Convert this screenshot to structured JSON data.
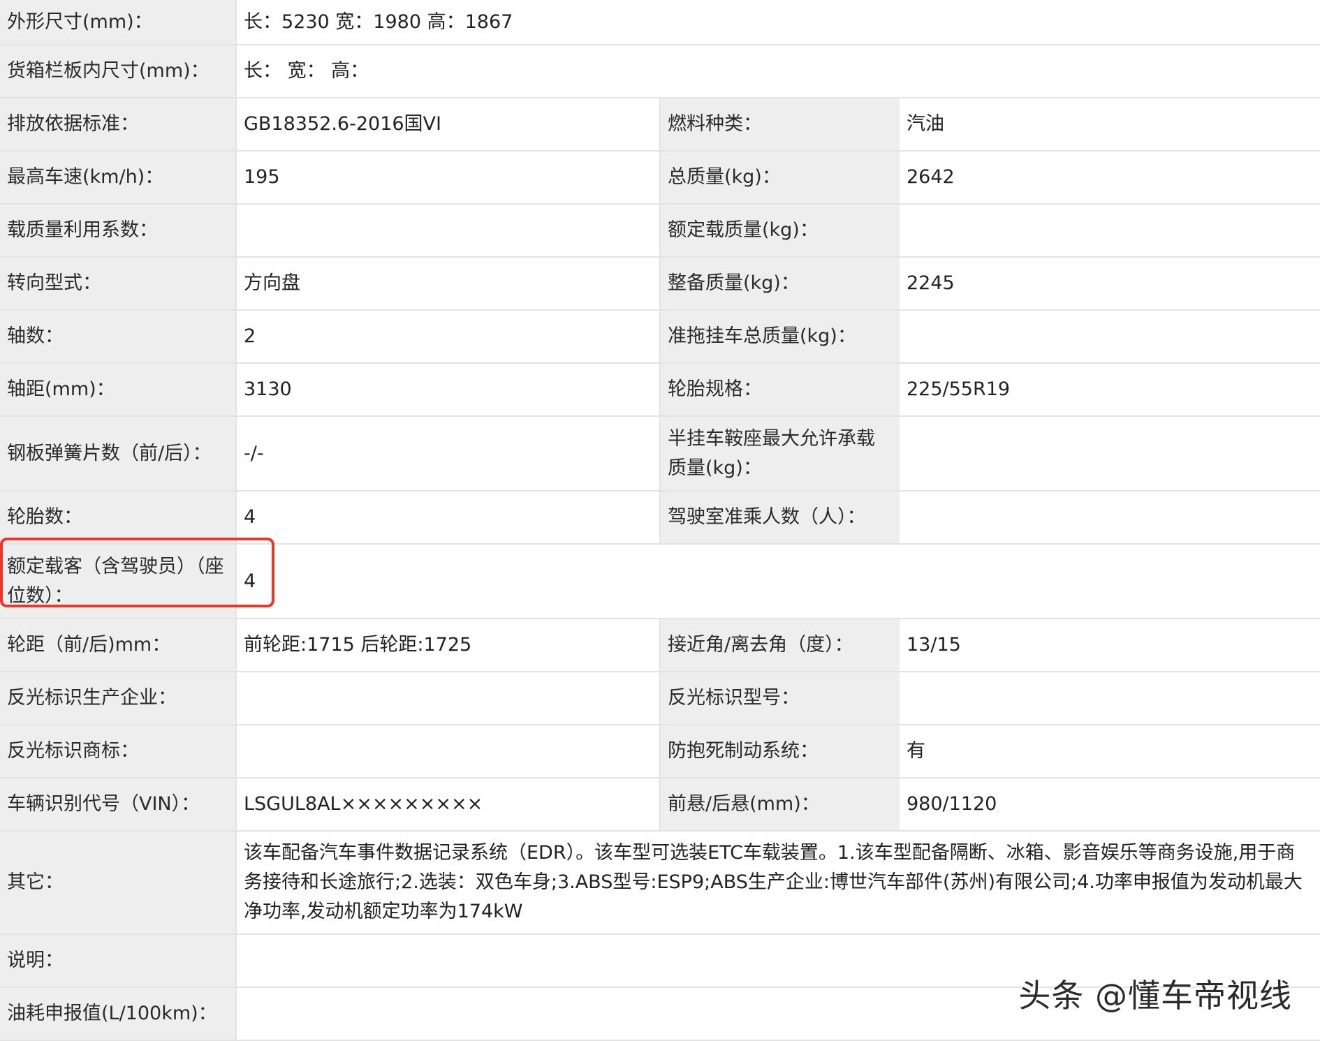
{
  "spec": {
    "dims_label": "外形尺寸(mm)：",
    "dims_value": "长：5230 宽：1980 高：1867",
    "cargo_label": "货箱栏板内尺寸(mm)：",
    "cargo_value": "长：  宽：  高：",
    "emission_label": "排放依据标准：",
    "emission_value": "GB18352.6-2016国VI",
    "fuel_label": "燃料种类：",
    "fuel_value": "汽油",
    "speed_label": "最高车速(km/h)：",
    "speed_value": "195",
    "total_mass_label": "总质量(kg)：",
    "total_mass_value": "2642",
    "load_coef_label": "载质量利用系数：",
    "load_coef_value": "",
    "rated_load_label": "额定载质量(kg)：",
    "rated_load_value": "",
    "steering_label": "转向型式：",
    "steering_value": "方向盘",
    "curb_mass_label": "整备质量(kg)：",
    "curb_mass_value": "2245",
    "axles_label": "轴数：",
    "axles_value": "2",
    "trailer_label": "准拖挂车总质量(kg)：",
    "trailer_value": "",
    "wheelbase_label": "轴距(mm)：",
    "wheelbase_value": "3130",
    "tire_spec_label": "轮胎规格：",
    "tire_spec_value": "225/55R19",
    "leaf_label": "钢板弹簧片数（前/后）：",
    "leaf_value": "-/-",
    "saddle_label": "半挂车鞍座最大允许承载质量(kg)：",
    "saddle_value": "",
    "tires_label": "轮胎数：",
    "tires_value": "4",
    "cab_label": "驾驶室准乘人数（人）：",
    "cab_value": "",
    "seats_label": "额定载客（含驾驶员）（座位数）：",
    "seats_value": "4",
    "track_label": "轮距（前/后)mm：",
    "track_value": "前轮距:1715 后轮距:1725",
    "angle_label": "接近角/离去角（度）：",
    "angle_value": "13/15",
    "refl_maker_label": "反光标识生产企业：",
    "refl_maker_value": "",
    "refl_model_label": "反光标识型号：",
    "refl_model_value": "",
    "refl_brand_label": "反光标识商标：",
    "refl_brand_value": "",
    "abs_label": "防抱死制动系统：",
    "abs_value": "有",
    "vin_label": "车辆识别代号（VIN）：",
    "vin_value": "LSGUL8AL×××××××××",
    "overhang_label": "前悬/后悬(mm)：",
    "overhang_value": "980/1120",
    "other_label": "其它：",
    "other_value": "该车配备汽车事件数据记录系统（EDR）。该车型可选装ETC车载装置。1.该车型配备隔断、冰箱、影音娱乐等商务设施,用于商务接待和长途旅行;2.选装：双色车身;3.ABS型号:ESP9;ABS生产企业:博世汽车部件(苏州)有限公司;4.功率申报值为发动机最大净功率,发动机额定功率为174kW",
    "notes_label": "说明：",
    "notes_value": "",
    "fuel_cons_label": "油耗申报值(L/100km)：",
    "fuel_cons_value": ""
  },
  "watermark": "头条 @懂车帝视线",
  "colors": {
    "highlight": "#e8372d",
    "label_bg": "#eeeeee",
    "border": "#e3e3e3"
  }
}
